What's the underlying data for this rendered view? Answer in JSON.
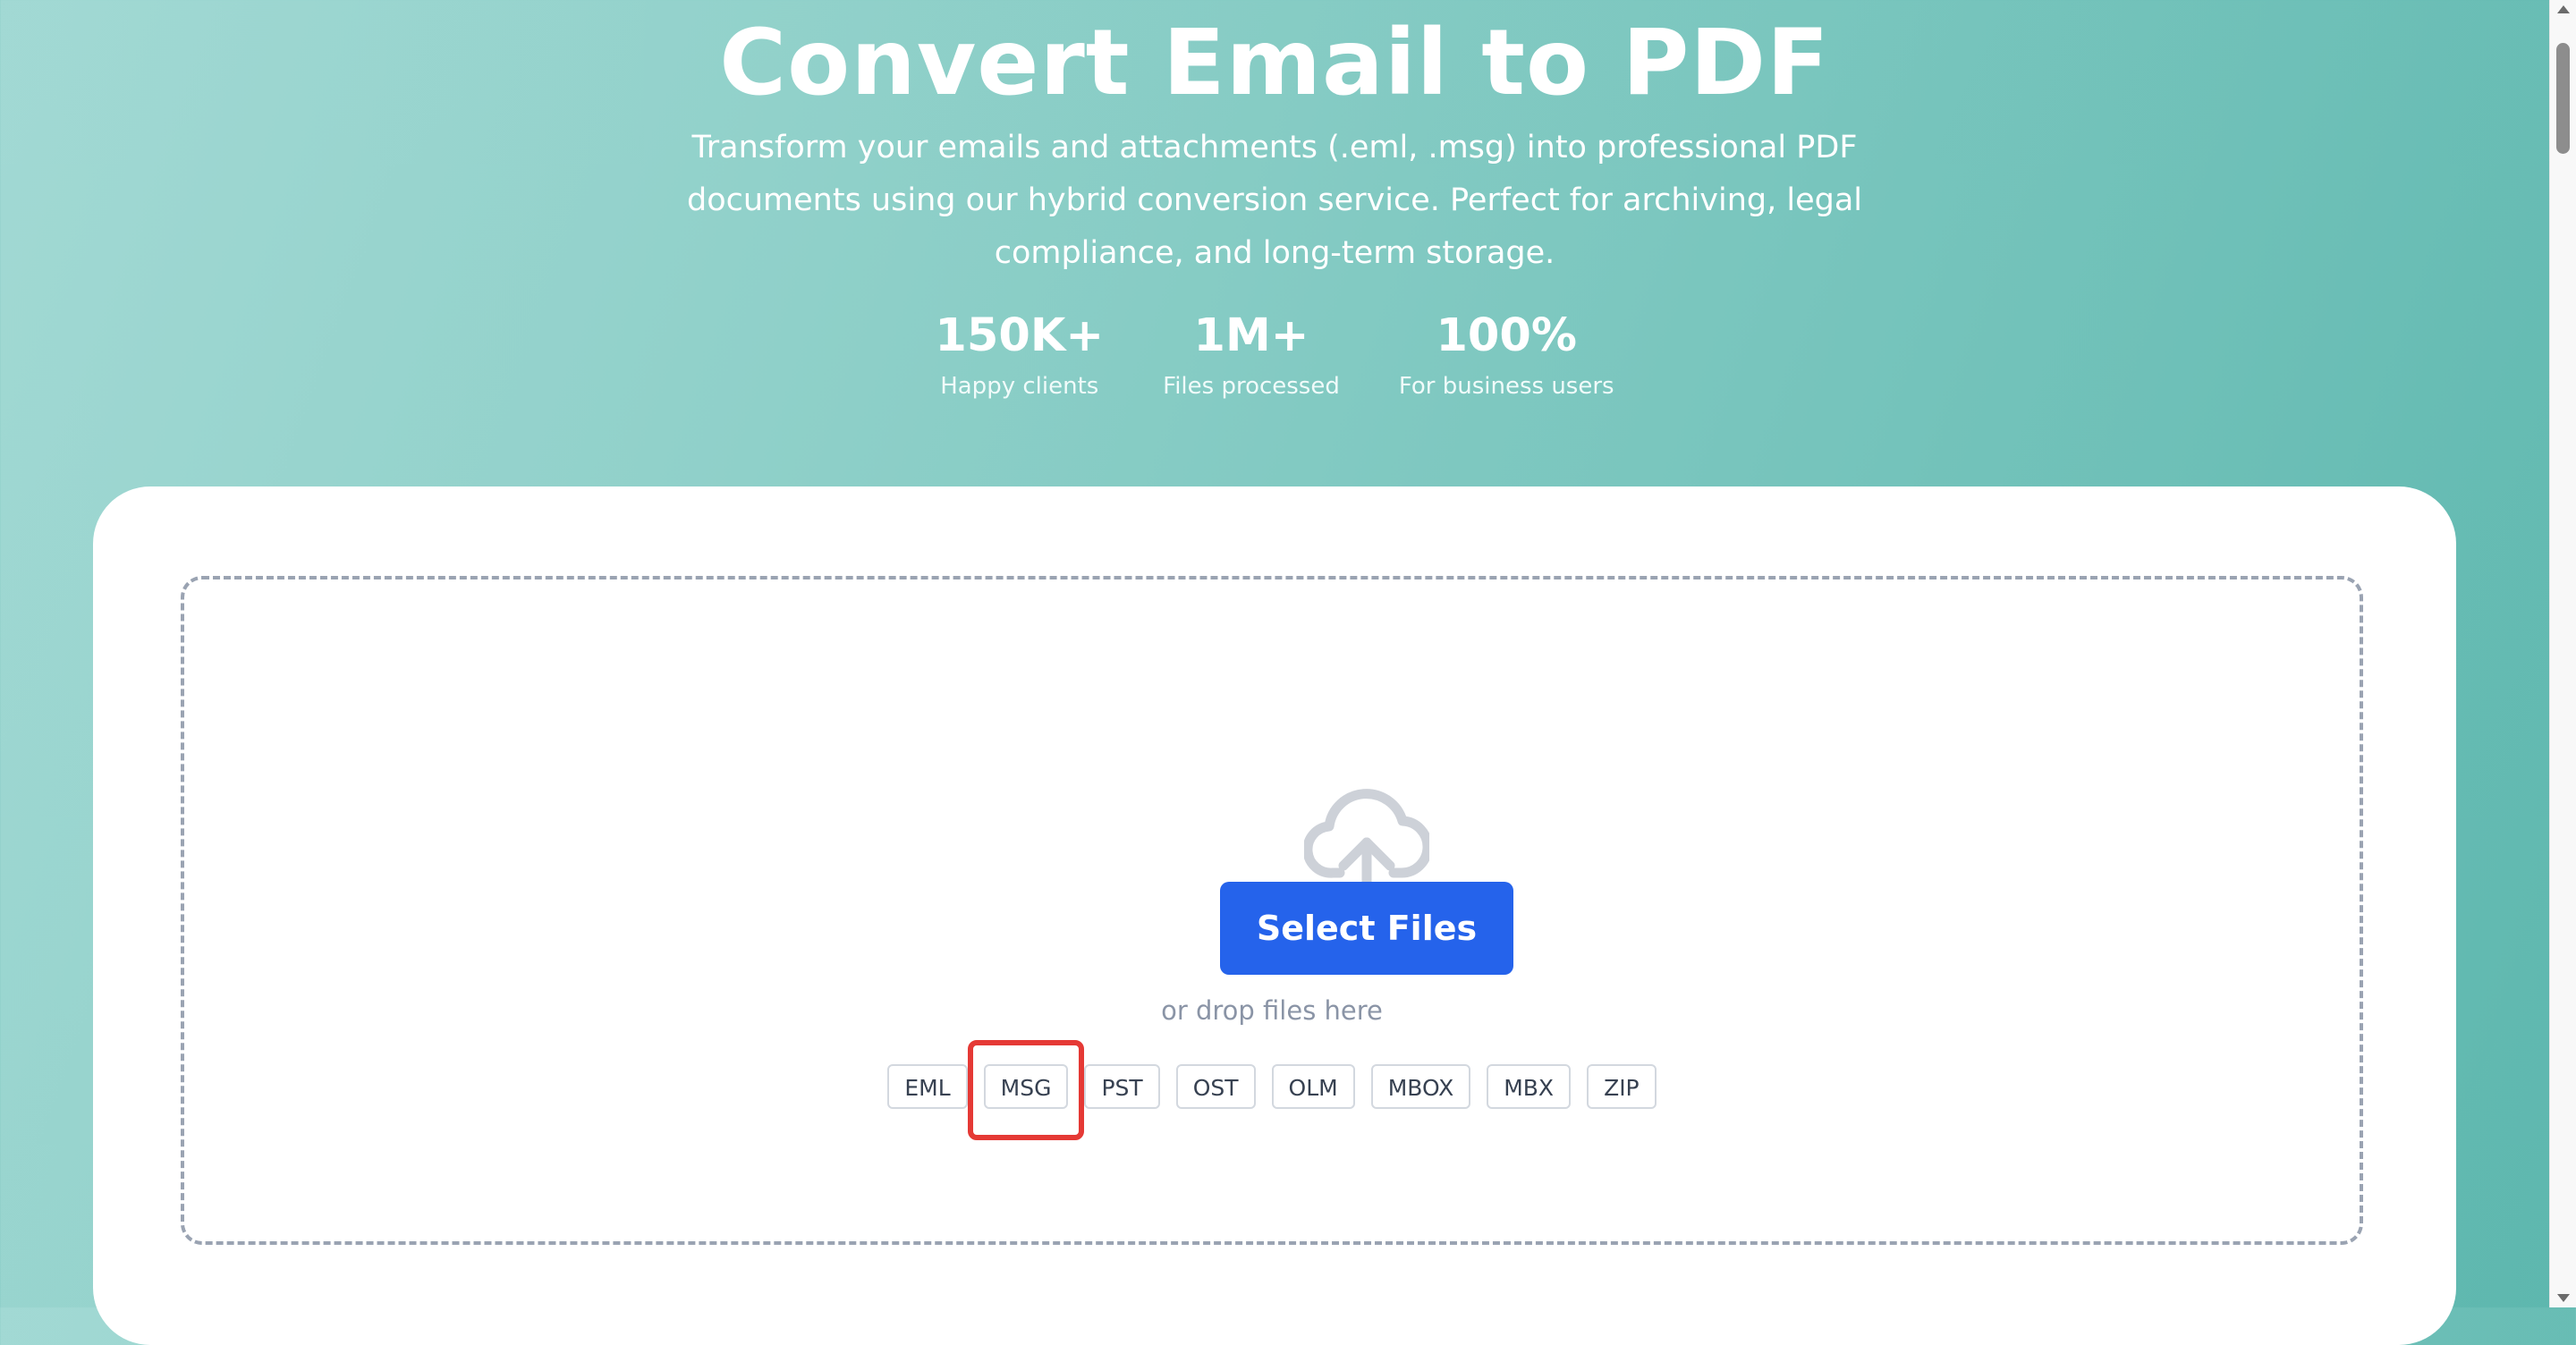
{
  "hero": {
    "title": "Convert Email to PDF",
    "subtitle_lines": [
      "Transform your emails and attachments (.eml, .msg) into professional PDF",
      "documents using our hybrid conversion service. Perfect for archiving, legal",
      "compliance, and long-term storage."
    ],
    "stats": [
      {
        "value": "150K+",
        "label": "Happy clients"
      },
      {
        "value": "1M+",
        "label": "Files processed"
      },
      {
        "value": "100%",
        "label": "For business users"
      }
    ]
  },
  "upload": {
    "icon": "cloud-upload-icon",
    "button_label": "Select Files",
    "drop_hint": "or drop files here",
    "formats": [
      "EML",
      "MSG",
      "PST",
      "OST",
      "OLM",
      "MBOX",
      "MBX",
      "ZIP"
    ],
    "highlighted_format": "MSG"
  },
  "colors": {
    "background_start": "#a2d9d4",
    "background_end": "#5db7ae",
    "accent": "#2563eb",
    "highlight": "#e53935"
  }
}
